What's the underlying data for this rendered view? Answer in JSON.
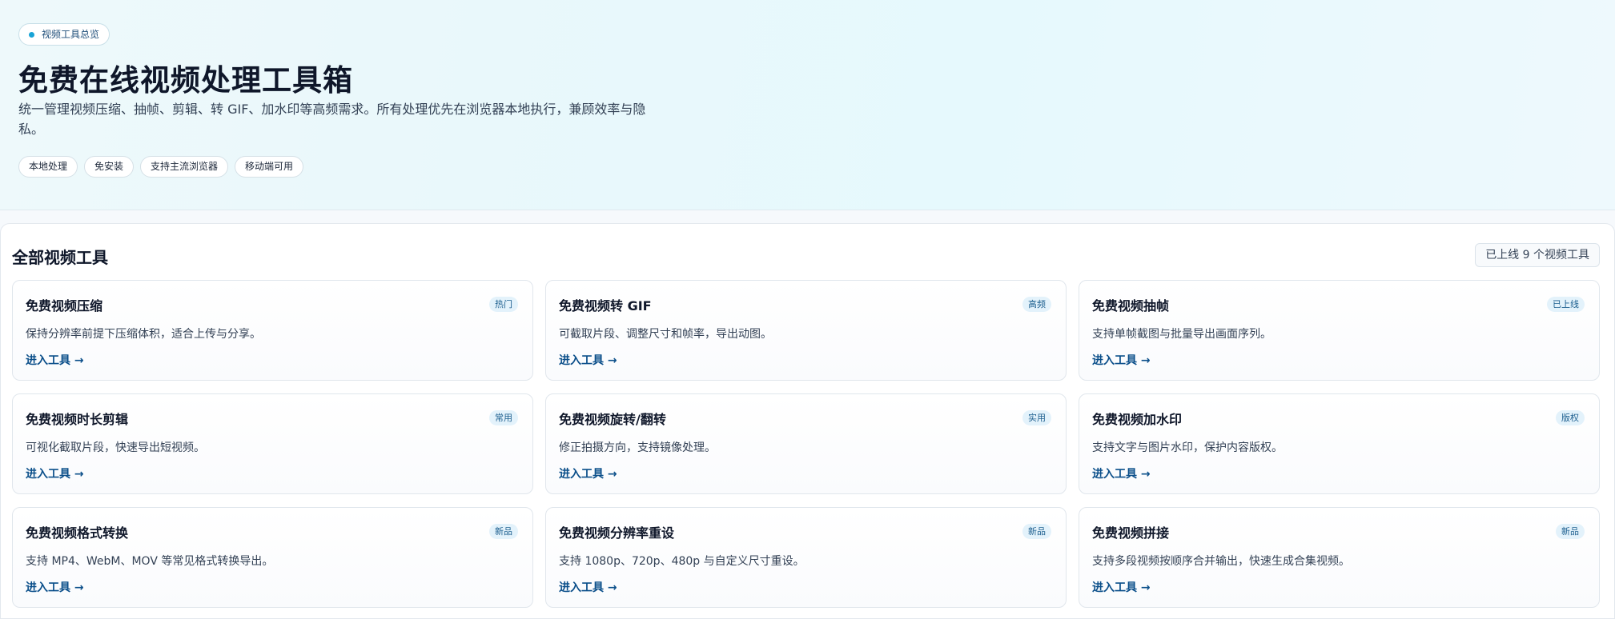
{
  "hero": {
    "badge": "视频工具总览",
    "title": "免费在线视频处理工具箱",
    "description": "统一管理视频压缩、抽帧、剪辑、转 GIF、加水印等高频需求。所有处理优先在浏览器本地执行，兼顾效率与隐私。",
    "tags": [
      "本地处理",
      "免安装",
      "支持主流浏览器",
      "移动端可用"
    ]
  },
  "section": {
    "title": "全部视频工具",
    "count_label": "已上线 9 个视频工具"
  },
  "link_label": "进入工具 →",
  "tools": [
    {
      "title": "免费视频压缩",
      "badge": "热门",
      "description": "保持分辨率前提下压缩体积，适合上传与分享。"
    },
    {
      "title": "免费视频转 GIF",
      "badge": "高频",
      "description": "可截取片段、调整尺寸和帧率，导出动图。"
    },
    {
      "title": "免费视频抽帧",
      "badge": "已上线",
      "description": "支持单帧截图与批量导出画面序列。"
    },
    {
      "title": "免费视频时长剪辑",
      "badge": "常用",
      "description": "可视化截取片段，快速导出短视频。"
    },
    {
      "title": "免费视频旋转/翻转",
      "badge": "实用",
      "description": "修正拍摄方向，支持镜像处理。"
    },
    {
      "title": "免费视频加水印",
      "badge": "版权",
      "description": "支持文字与图片水印，保护内容版权。"
    },
    {
      "title": "免费视频格式转换",
      "badge": "新品",
      "description": "支持 MP4、WebM、MOV 等常见格式转换导出。"
    },
    {
      "title": "免费视频分辨率重设",
      "badge": "新品",
      "description": "支持 1080p、720p、480p 与自定义尺寸重设。"
    },
    {
      "title": "免费视频拼接",
      "badge": "新品",
      "description": "支持多段视频按顺序合并输出，快速生成合集视频。"
    }
  ]
}
